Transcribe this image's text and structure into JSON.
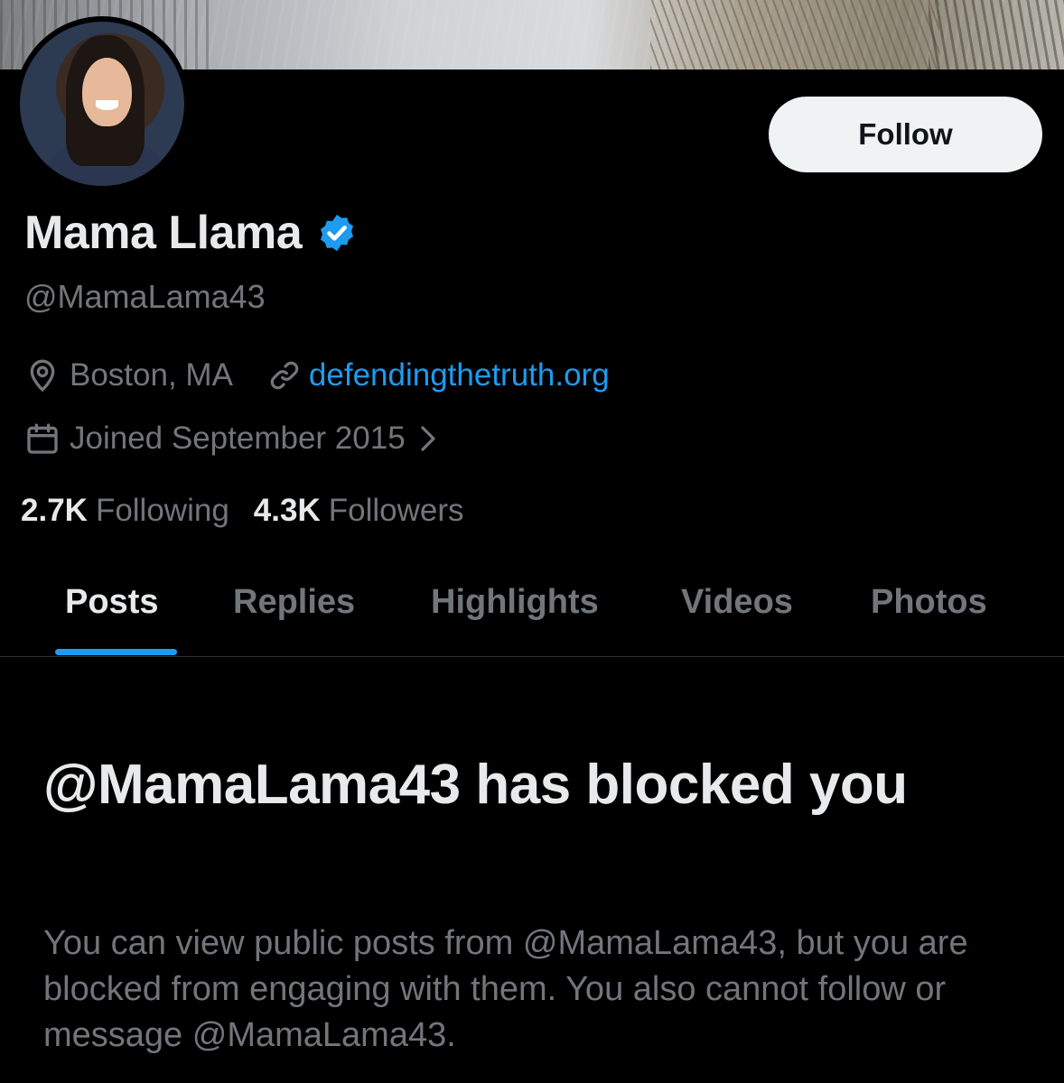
{
  "profile": {
    "display_name": "Mama Llama",
    "handle": "@MamaLama43",
    "location": "Boston, MA",
    "website": "defendingthetruth.org",
    "joined": "Joined September 2015",
    "following_count": "2.7K",
    "following_label": "Following",
    "followers_count": "4.3K",
    "followers_label": "Followers",
    "verified": true
  },
  "actions": {
    "follow_label": "Follow"
  },
  "tabs": [
    {
      "label": "Posts",
      "active": true
    },
    {
      "label": "Replies",
      "active": false
    },
    {
      "label": "Highlights",
      "active": false
    },
    {
      "label": "Videos",
      "active": false
    },
    {
      "label": "Photos",
      "active": false
    }
  ],
  "blocked": {
    "title": "@MamaLama43 has blocked you",
    "description": "You can view public posts from @MamaLama43, but you are blocked from engaging with them. You also cannot follow or message @MamaLama43."
  },
  "colors": {
    "background": "#000000",
    "text_primary": "#e7e9ea",
    "text_secondary": "#71767b",
    "accent": "#1d9bf0",
    "follow_button_bg": "#eff3f4"
  }
}
